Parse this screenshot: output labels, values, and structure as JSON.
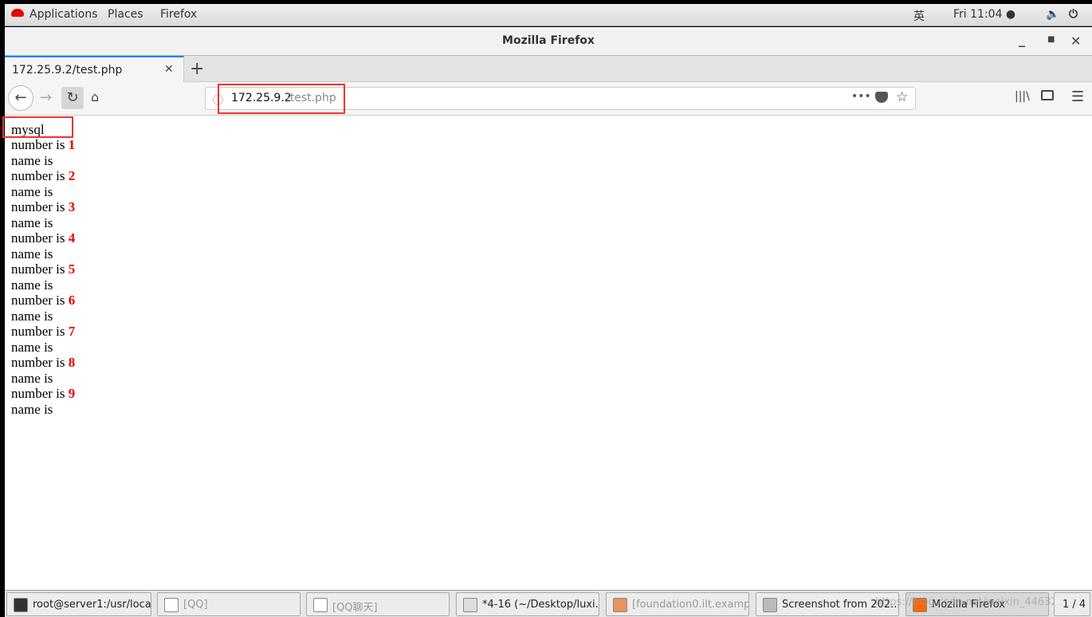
{
  "topbar": {
    "applications": "Applications",
    "places": "Places",
    "firefox": "Firefox",
    "input_method": "英",
    "clock": "Fri 11:04 ●"
  },
  "window": {
    "title": "Mozilla Firefox"
  },
  "tab": {
    "label": "172.25.9.2/test.php"
  },
  "url": {
    "host": "172.25.9.2",
    "path": "/test.php"
  },
  "content": {
    "heading": "mysql",
    "rows": [
      {
        "label": "number is ",
        "number": "1",
        "name": "name is"
      },
      {
        "label": "number is ",
        "number": "2",
        "name": "name is"
      },
      {
        "label": "number is ",
        "number": "3",
        "name": "name is"
      },
      {
        "label": "number is ",
        "number": "4",
        "name": "name is"
      },
      {
        "label": "number is ",
        "number": "5",
        "name": "name is"
      },
      {
        "label": "number is ",
        "number": "6",
        "name": "name is"
      },
      {
        "label": "number is ",
        "number": "7",
        "name": "name is"
      },
      {
        "label": "number is ",
        "number": "8",
        "name": "name is"
      },
      {
        "label": "number is ",
        "number": "9",
        "name": "name is"
      }
    ]
  },
  "taskbar": {
    "items": [
      {
        "label": "root@server1:/usr/local",
        "color": "#333"
      },
      {
        "label": "[QQ]",
        "color": "#fff"
      },
      {
        "label": "[QQ聊天]",
        "color": "#fff"
      },
      {
        "label": "*4-16 (~/Desktop/luxi...",
        "color": "#ddd"
      },
      {
        "label": "[foundation0.ilt.exampl...",
        "color": "#e8945a"
      },
      {
        "label": "Screenshot from 202...",
        "color": "#bbb"
      },
      {
        "label": "Mozilla Firefox",
        "color": "#f60"
      }
    ],
    "workspace": "1 / 4"
  },
  "watermark": "https://blog.csdn.net/weixin_44632..."
}
